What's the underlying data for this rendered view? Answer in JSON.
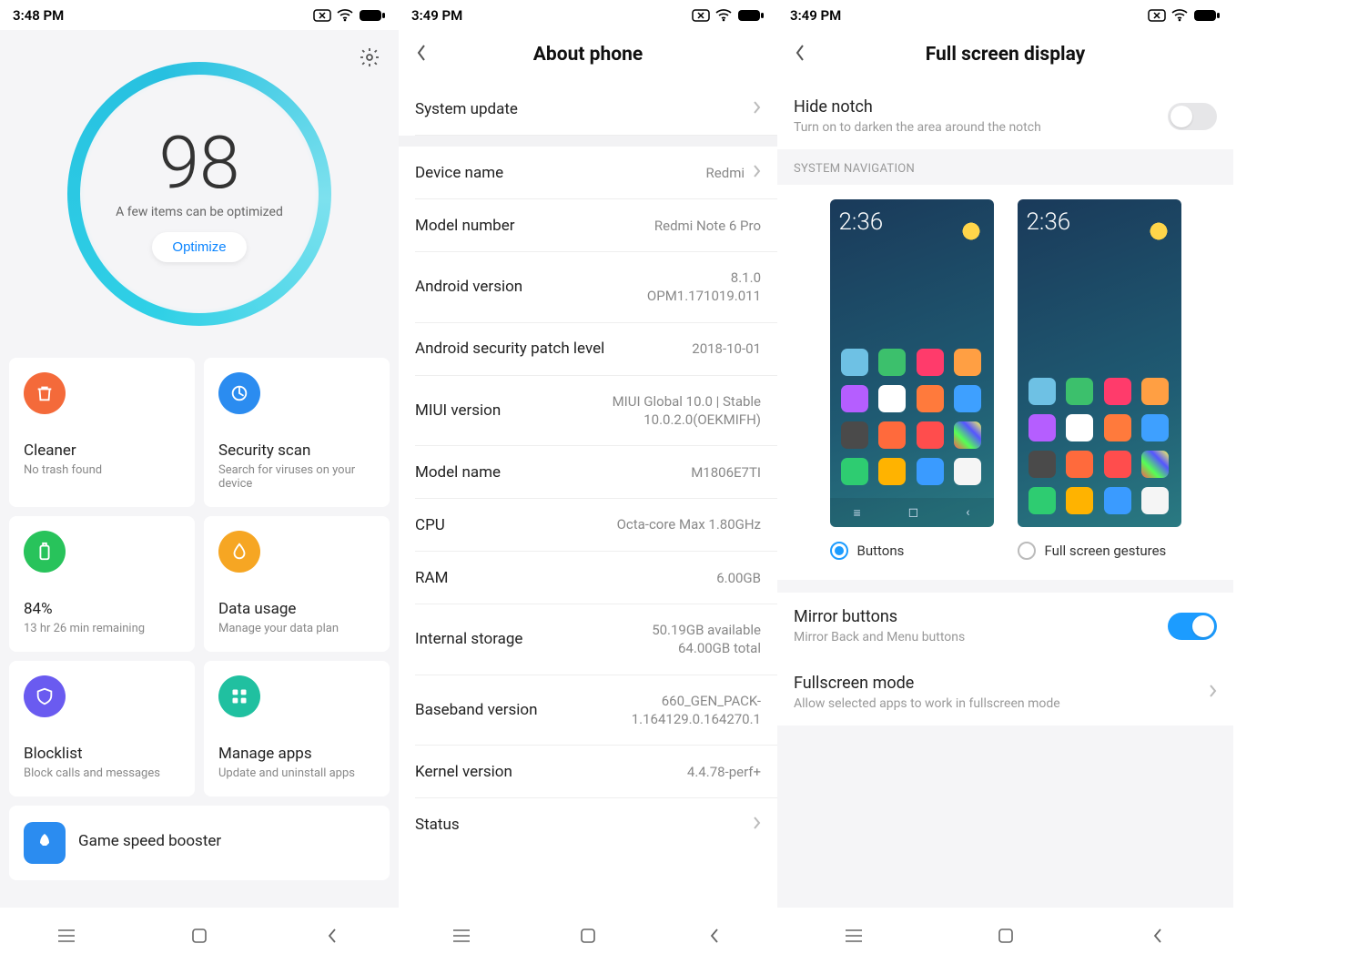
{
  "screen1": {
    "status_time": "3:48 PM",
    "score": "98",
    "score_subtitle": "A few items can be optimized",
    "optimize_label": "Optimize",
    "tiles": {
      "cleaner": {
        "title": "Cleaner",
        "sub": "No trash found"
      },
      "securityscan": {
        "title": "Security scan",
        "sub": "Search for viruses on your device"
      },
      "battery": {
        "title": "84%",
        "sub": "13 hr 26 min  remaining"
      },
      "datausage": {
        "title": "Data usage",
        "sub": "Manage your data plan"
      },
      "blocklist": {
        "title": "Blocklist",
        "sub": "Block calls and messages"
      },
      "manageapps": {
        "title": "Manage apps",
        "sub": "Update and uninstall apps"
      },
      "gamespeed": {
        "title": "Game speed booster"
      }
    }
  },
  "screen2": {
    "status_time": "3:49 PM",
    "title": "About phone",
    "rows": {
      "system_update": "System update",
      "device_name": {
        "label": "Device name",
        "value": "Redmi"
      },
      "model_number": {
        "label": "Model number",
        "value": "Redmi Note 6 Pro"
      },
      "android_version": {
        "label": "Android version",
        "value": "8.1.0\nOPM1.171019.011"
      },
      "security_patch": {
        "label": "Android security patch level",
        "value": "2018-10-01"
      },
      "miui_version": {
        "label": "MIUI version",
        "value": "MIUI Global 10.0 | Stable\n10.0.2.0(OEKMIFH)"
      },
      "model_name": {
        "label": "Model name",
        "value": "M1806E7TI"
      },
      "cpu": {
        "label": "CPU",
        "value": "Octa-core Max 1.80GHz"
      },
      "ram": {
        "label": "RAM",
        "value": "6.00GB"
      },
      "storage": {
        "label": "Internal storage",
        "value": "50.19GB available\n64.00GB total"
      },
      "baseband": {
        "label": "Baseband version",
        "value": "660_GEN_PACK-1.164129.0.164270.1"
      },
      "kernel": {
        "label": "Kernel version",
        "value": "4.4.78-perf+"
      },
      "status": {
        "label": "Status"
      }
    }
  },
  "screen3": {
    "status_time": "3:49 PM",
    "title": "Full screen display",
    "hide_notch": {
      "title": "Hide notch",
      "sub": "Turn on to darken the area around the notch"
    },
    "section_nav": "SYSTEM NAVIGATION",
    "preview_time": "2:36",
    "option_buttons": "Buttons",
    "option_gestures": "Full screen gestures",
    "mirror": {
      "title": "Mirror buttons",
      "sub": "Mirror Back and Menu buttons"
    },
    "fullscreen_mode": {
      "title": "Fullscreen mode",
      "sub": "Allow selected apps to work in fullscreen mode"
    }
  }
}
